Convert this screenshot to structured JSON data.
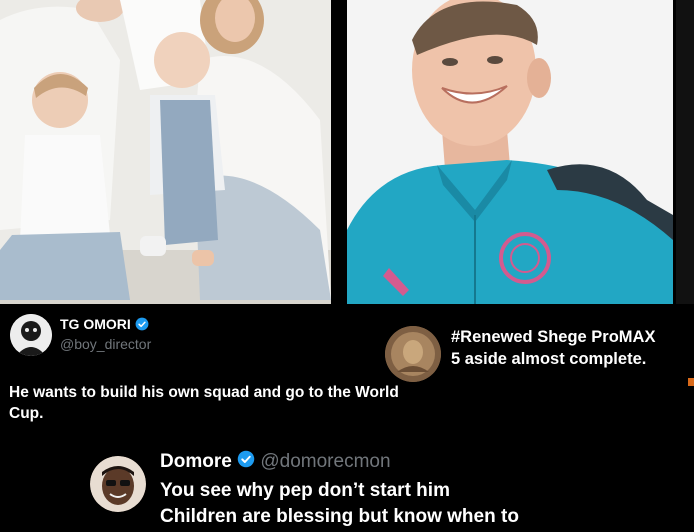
{
  "tweet1": {
    "display_name": "TG OMORI",
    "handle": "@boy_director",
    "text": "He wants to build his own squad and go to the World Cup."
  },
  "quote1": {
    "line1": "#Renewed Shege ProMAX",
    "line2": "5 aside almost complete."
  },
  "tweet2": {
    "display_name": "Domore",
    "handle": "@domorecmon",
    "line1": "You see why pep don’t start him",
    "line2": "Children are blessing but know when to"
  },
  "colors": {
    "background": "#000000",
    "verified": "#1d9bf0",
    "handle": "#71767b",
    "jersey": "#22a7c4"
  }
}
